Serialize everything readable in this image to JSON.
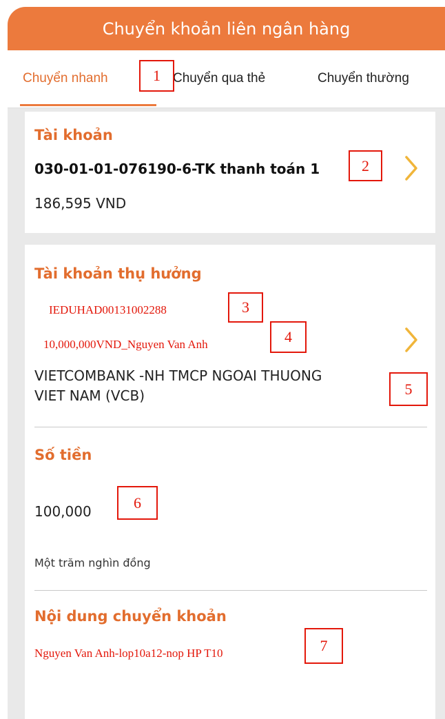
{
  "header": {
    "title": "Chuyển khoản liên ngân hàng"
  },
  "tabs": [
    {
      "label": "Chuyển nhanh",
      "active": true
    },
    {
      "label": "Chuyển qua thẻ",
      "active": false
    },
    {
      "label": "Chuyển thường",
      "active": false
    }
  ],
  "source_account": {
    "heading": "Tài khoản",
    "account": "030-01-01-076190-6-TK thanh toán 1",
    "balance": "186,595 VND"
  },
  "beneficiary": {
    "heading": "Tài khoản thụ hưởng",
    "account_number": "IEDUHAD00131002288",
    "account_name": "10,000,000VND_Nguyen Van Anh",
    "bank_name_line1": "VIETCOMBANK -NH TMCP NGOAI THUONG",
    "bank_name_line2": "VIET NAM (VCB)"
  },
  "amount": {
    "heading": "Số tiền",
    "value": "100,000",
    "in_words": "Một trăm nghìn đồng"
  },
  "transfer_content": {
    "heading": "Nội dung chuyển khoản",
    "value": "Nguyen Van Anh-lop10a12-nop HP T10"
  },
  "annotations": [
    "1",
    "2",
    "3",
    "4",
    "5",
    "6",
    "7"
  ],
  "colors": {
    "brand_orange": "#ec7a3d",
    "annotation_red": "#e3170a",
    "chevron_yellow": "#f0b53a"
  },
  "icons": {
    "chevron": "chevron-right-icon"
  }
}
